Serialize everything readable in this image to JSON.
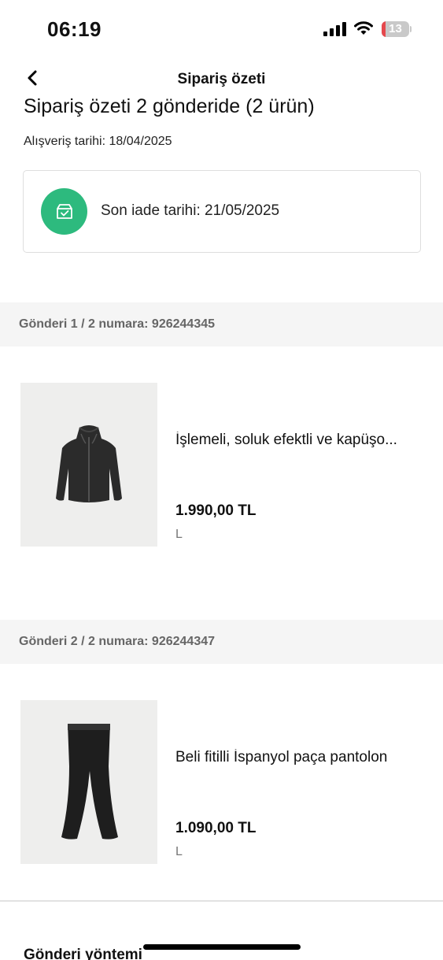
{
  "status_bar": {
    "time": "06:19",
    "battery_level": "13",
    "battery_fraction": 0.13,
    "battery_color": "#e5484d",
    "icons": [
      "signal-icon",
      "wifi-icon",
      "battery-icon"
    ]
  },
  "header": {
    "back_icon": "chevron-left-icon",
    "title": "Sipariş özeti"
  },
  "summary": {
    "heading": "Sipariş özeti 2 gönderide (2 ürün)",
    "purchase_date": "Alışveriş tarihi: 18/04/2025"
  },
  "return_info": {
    "icon": "return-box-icon",
    "accent_color": "#2dba7e",
    "text": "Son iade tarihi: 21/05/2025"
  },
  "shipments": [
    {
      "label": "Gönderi 1 / 2 numara: 926244345",
      "product": {
        "image": "hoodie-image",
        "name": "İşlemeli, soluk efektli ve kapüşo...",
        "price": "1.990,00 TL",
        "size": "L"
      }
    },
    {
      "label": "Gönderi 2 / 2 numara: 926244347",
      "product": {
        "image": "pants-image",
        "name": "Beli fitilli İspanyol paça pantolon",
        "price": "1.090,00 TL",
        "size": "L"
      }
    }
  ],
  "shipping_method": {
    "title": "Gönderi yöntemi"
  }
}
